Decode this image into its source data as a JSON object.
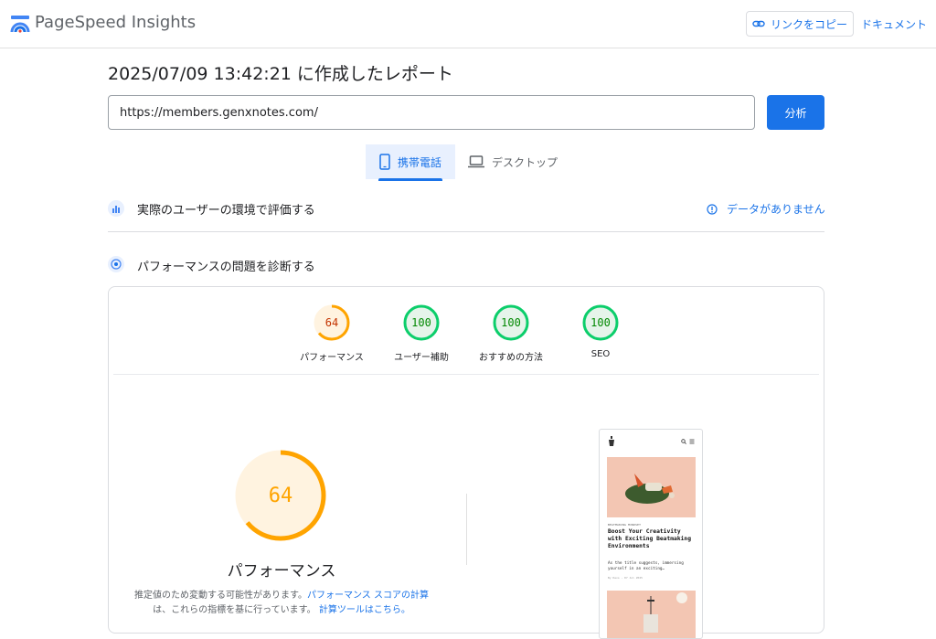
{
  "header": {
    "app_title": "PageSpeed Insights",
    "copy_link_label": "リンクをコピー",
    "docs_label": "ドキュメント",
    "logo_icon": "pagespeed-logo-icon",
    "link_icon": "link-icon"
  },
  "report": {
    "title": "2025/07/09 13:42:21 に作成したレポート"
  },
  "search": {
    "url_value": "https://members.genxnotes.com/",
    "analyze_label": "分析"
  },
  "device_tabs": [
    {
      "label": "携帯電話",
      "icon": "smartphone-icon",
      "selected": true
    },
    {
      "label": "デスクトップ",
      "icon": "laptop-icon",
      "selected": false
    }
  ],
  "field_data": {
    "title": "実際のユーザーの環境で評価する",
    "status": "データがありません",
    "status_icon": "info-icon"
  },
  "lab_data": {
    "title": "パフォーマンスの問題を診断する"
  },
  "categories": [
    {
      "score": "64",
      "label": "パフォーマンス",
      "color": "#ffa400",
      "text_color": "#c33300",
      "fill": "#fff3e0"
    },
    {
      "score": "100",
      "label": "ユーザー補助",
      "color": "#0cce6b",
      "text_color": "#008800",
      "fill": "#e6f4ea"
    },
    {
      "score": "100",
      "label": "おすすめの方法",
      "color": "#0cce6b",
      "text_color": "#008800",
      "fill": "#e6f4ea"
    },
    {
      "score": "100",
      "label": "SEO",
      "color": "#0cce6b",
      "text_color": "#008800",
      "fill": "#e6f4ea"
    }
  ],
  "performance": {
    "score": "64",
    "score_fraction": 0.64,
    "title": "パフォーマンス",
    "desc_part1": "推定値のため変動する可能性があります。",
    "desc_link1": "パフォーマンス スコアの計算",
    "desc_part2": "は、これらの指標を基に行っています。",
    "desc_link2": "計算ツールはこちら。"
  },
  "screenshot": {
    "category": "BEATMAKING MINDSET",
    "headline": "Boost Your Creativity with Exciting Beatmaking Environments",
    "excerpt": "As the title suggests, immersing yourself in an exciting…",
    "meta": "By Kevs · 07 Jul 2025"
  }
}
